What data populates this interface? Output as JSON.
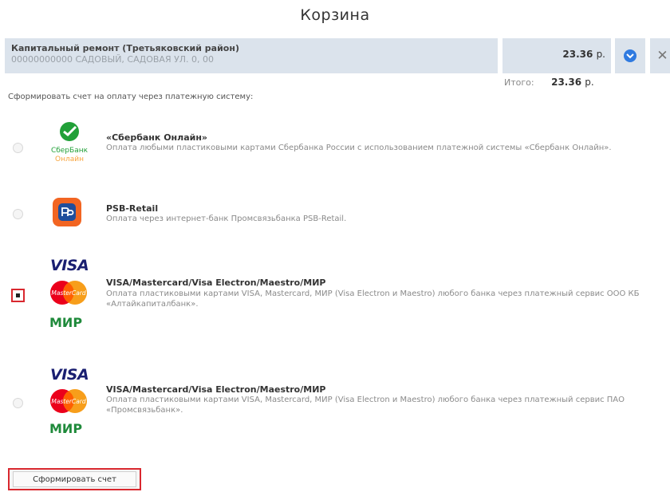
{
  "page": {
    "title": "Корзина"
  },
  "cart": {
    "item_name": "Капитальный ремонт (Третьяковский район)",
    "item_address": "00000000000 САДОВЫЙ, САДОВАЯ УЛ. 0, 00",
    "price": "23.36",
    "currency": "р.",
    "total_label": "Итого:",
    "total_value": "23.36",
    "open_icon": "chevron-down-icon",
    "remove_icon": "close-icon",
    "remove_symbol": "✕"
  },
  "payment": {
    "intro": "Сформировать счет на оплату через платежную систему:",
    "options": [
      {
        "title": "«Сбербанк Онлайн»",
        "desc": "Оплата любыми пластиковыми картами Сбербанка России с использованием платежной системы «Сбербанк Онлайн».",
        "logo_text_1": "СберБанк",
        "logo_text_2": "Онлайн",
        "selected": false
      },
      {
        "title": "PSB-Retail",
        "desc": "Оплата через интернет-банк Промсвязьбанка PSB-Retail.",
        "selected": false
      },
      {
        "title": "VISA/Mastercard/Visa Electron/Maestro/МИР",
        "desc": "Оплата пластиковыми картами VISA, Mastercard, МИР (Visa Electron и Maestro) любого банка через платежный сервис ООО КБ «Алтайкапиталбанк».",
        "logo_visa": "VISA",
        "logo_mc": "MasterCard",
        "logo_mir": "МИР",
        "selected": true
      },
      {
        "title": "VISA/Mastercard/Visa Electron/Maestro/МИР",
        "desc": "Оплата пластиковыми картами VISA, Mastercard, МИР (Visa Electron и Maestro) любого банка через платежный сервис ПАО «Промсвязьбанк».",
        "logo_visa": "VISA",
        "logo_mc": "MasterCard",
        "logo_mir": "МИР",
        "selected": false
      }
    ]
  },
  "submit_label": "Сформировать счет",
  "colors": {
    "accent_red": "#d9282f",
    "row_bg": "#dbe3ec",
    "sber_green": "#21a038",
    "psb_orange": "#f26522",
    "psb_blue": "#1f4e9c",
    "visa_blue": "#1a1f71",
    "mc_red": "#eb001b",
    "mc_orange": "#f79e1b",
    "mir_green": "#1f8a3b"
  }
}
